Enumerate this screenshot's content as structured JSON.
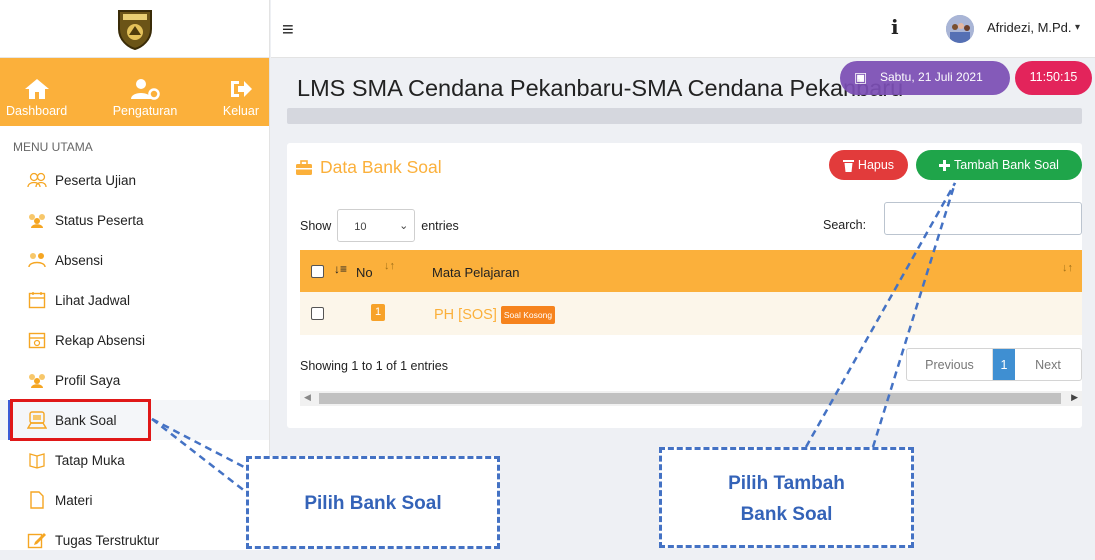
{
  "quick_menu": {
    "dashboard": "Dashboard",
    "settings": "Pengaturan",
    "logout": "Keluar"
  },
  "menu": {
    "title": "MENU UTAMA",
    "items": [
      {
        "label": "Peserta Ujian",
        "icon": "users-icon"
      },
      {
        "label": "Status Peserta",
        "icon": "group-icon"
      },
      {
        "label": "Absensi",
        "icon": "attendance-icon"
      },
      {
        "label": "Lihat Jadwal",
        "icon": "calendar-icon"
      },
      {
        "label": "Rekap Absensi",
        "icon": "calendar-refresh-icon"
      },
      {
        "label": "Profil Saya",
        "icon": "profile-icon"
      },
      {
        "label": "Bank Soal",
        "icon": "question-bank-icon",
        "active": true
      },
      {
        "label": "Tatap Muka",
        "icon": "book-icon"
      },
      {
        "label": "Materi",
        "icon": "file-icon"
      },
      {
        "label": "Tugas Terstruktur",
        "icon": "edit-icon"
      }
    ]
  },
  "header": {
    "menu_icon": "≡",
    "info_icon": "i",
    "user_name": "Afridezi, M.Pd.",
    "caret": "▾"
  },
  "page": {
    "title": "LMS SMA Cendana Pekanbaru-SMA Cendana Pekanbaru",
    "date": "Sabtu, 21 Juli 2021",
    "time": "11:50:15"
  },
  "card": {
    "title": "Data Bank Soal",
    "btn_delete": "Hapus",
    "btn_add": "Tambah Bank Soal",
    "show_label": "Show",
    "show_value": "10",
    "entries_label": "entries",
    "search_label": "Search:",
    "search_value": "",
    "columns": {
      "no": "No",
      "subject": "Mata Pelajaran"
    },
    "rows": [
      {
        "no": "1",
        "subject": "PH [SOS]",
        "badge": "Soal Kosong"
      }
    ],
    "info": "Showing 1 to 1 of 1 entries",
    "pager": {
      "prev": "Previous",
      "page": "1",
      "next": "Next"
    }
  },
  "annotations": {
    "callout_1": "Pilih Bank Soal",
    "callout_2_line1": "Pilih Tambah",
    "callout_2_line2": "Bank Soal"
  },
  "colors": {
    "accent": "#fbb03b",
    "danger": "#e23b3b",
    "success": "#1fa54a",
    "date_pill": "#7c4fb5",
    "time_pill": "#e3245b",
    "callout": "#4472c4",
    "highlight": "#e01818"
  }
}
